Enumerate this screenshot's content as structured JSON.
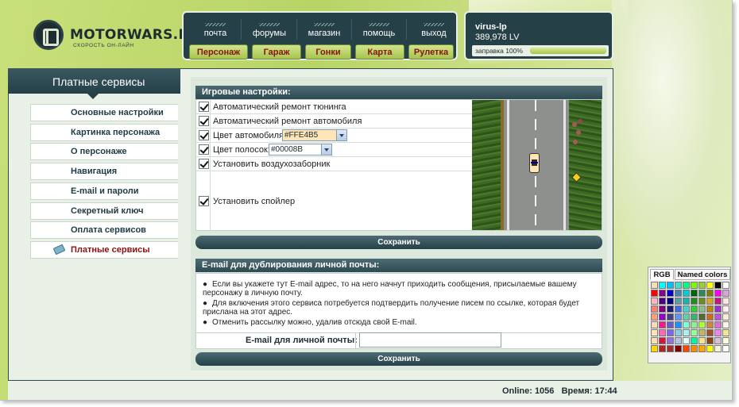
{
  "header": {
    "logo_title": "MOTORWARS.RU",
    "logo_subtitle": "СКОРОСТЬ ОН-ЛАЙН",
    "nav_links": [
      "почта",
      "форумы",
      "магазин",
      "помощь",
      "выход"
    ],
    "nav_buttons": [
      "Персонаж",
      "Гараж",
      "Гонки",
      "Карта",
      "Рулетка"
    ]
  },
  "user": {
    "name": "virus-lp",
    "money": "389,978 LV",
    "refuel_label": "заправка 100%",
    "refuel_percent": 100
  },
  "sidebar": {
    "title": "Платные сервисы",
    "items": [
      {
        "label": "Основные настройки"
      },
      {
        "label": "Картинка персонажа"
      },
      {
        "label": "О персонаже"
      },
      {
        "label": "Навигация"
      },
      {
        "label": "E-mail и пароли"
      },
      {
        "label": "Секретный ключ"
      },
      {
        "label": "Оплата сервисов"
      },
      {
        "label": "Платные сервисы",
        "active": true,
        "icon": "credit-card-icon"
      }
    ]
  },
  "game_settings": {
    "title": "Игровые настройки:",
    "options": [
      {
        "label": "Автоматический ремонт тюнинга",
        "checked": true
      },
      {
        "label": "Автоматический ремонт автомобиля",
        "checked": true
      },
      {
        "label": "Цвет автомобиля:",
        "checked": true,
        "value": "#FFE4B5"
      },
      {
        "label": "Цвет полосок:",
        "checked": true,
        "value": "#00008B"
      },
      {
        "label": "Установить воздухозаборник",
        "checked": true
      },
      {
        "label": "Установить спойлер",
        "checked": true
      }
    ],
    "save_label": "Сохранить"
  },
  "email_section": {
    "title": "E-mail для дублирования личной почты:",
    "bullets": [
      "Если вы укажете тут E-mail адрес, то на него начнут приходить сообщения, присылаемые вашему персонажу в личную почту.",
      "Для включения этого сервиса потребуется подтвердить получение писем по ссылке, которая будет прислана на этот адрес.",
      "Отменить рассылку можно, удалив отсюда свой E-mail."
    ],
    "field_label": "E-mail для личной почты:",
    "field_value": "",
    "save_label": "Сохранить"
  },
  "footer": {
    "online": "Online: 1056",
    "time": "Время: 17:44"
  },
  "color_picker": {
    "tabs": [
      "RGB",
      "Named colors"
    ],
    "swatches": [
      "#f5deb3",
      "#00ffff",
      "#00bfff",
      "#40e0d0",
      "#00ff7f",
      "#7cfc00",
      "#9acd32",
      "#ffff00",
      "#000000",
      "#ffffff",
      "#ff0000",
      "#8b008b",
      "#0000cd",
      "#4682b4",
      "#00ced1",
      "#006400",
      "#2e8b57",
      "#808000",
      "#ff00ff",
      "#dda0dd",
      "#ffb6c1",
      "#4b0082",
      "#000080",
      "#5f9ea0",
      "#20b2aa",
      "#228b22",
      "#6b8e23",
      "#daa520",
      "#c71585",
      "#ffe4e1",
      "#fa8072",
      "#800080",
      "#191970",
      "#4169e1",
      "#48d1cc",
      "#32cd32",
      "#8fbc8f",
      "#b8860b",
      "#9932cc",
      "#fff0f5",
      "#ffa07a",
      "#9400d3",
      "#483d8b",
      "#6495ed",
      "#66cdaa",
      "#3cb371",
      "#556b2f",
      "#d2691e",
      "#ba55d3",
      "#faebd7",
      "#ffdab9",
      "#ff1493",
      "#6a5acd",
      "#1e90ff",
      "#7fffd4",
      "#90ee90",
      "#adff2f",
      "#cd853f",
      "#da70d6",
      "#fdf5e6",
      "#ffe4b5",
      "#ff69b4",
      "#7b68ee",
      "#87ceeb",
      "#afeeee",
      "#98fb98",
      "#bdb76b",
      "#a0522d",
      "#ee82ee",
      "#f0e68c",
      "#ffdead",
      "#dc143c",
      "#9370db",
      "#b0c4de",
      "#e0ffff",
      "#00fa9a",
      "#f0e68c",
      "#8b4513",
      "#d8bfd8",
      "#ffffe0",
      "#ffd700",
      "#b22222",
      "#a52a2a",
      "#800000",
      "#ff4500",
      "#ff8c00",
      "#ffa500",
      "#ffff00",
      "#f5f5dc",
      "#ffffff"
    ]
  }
}
